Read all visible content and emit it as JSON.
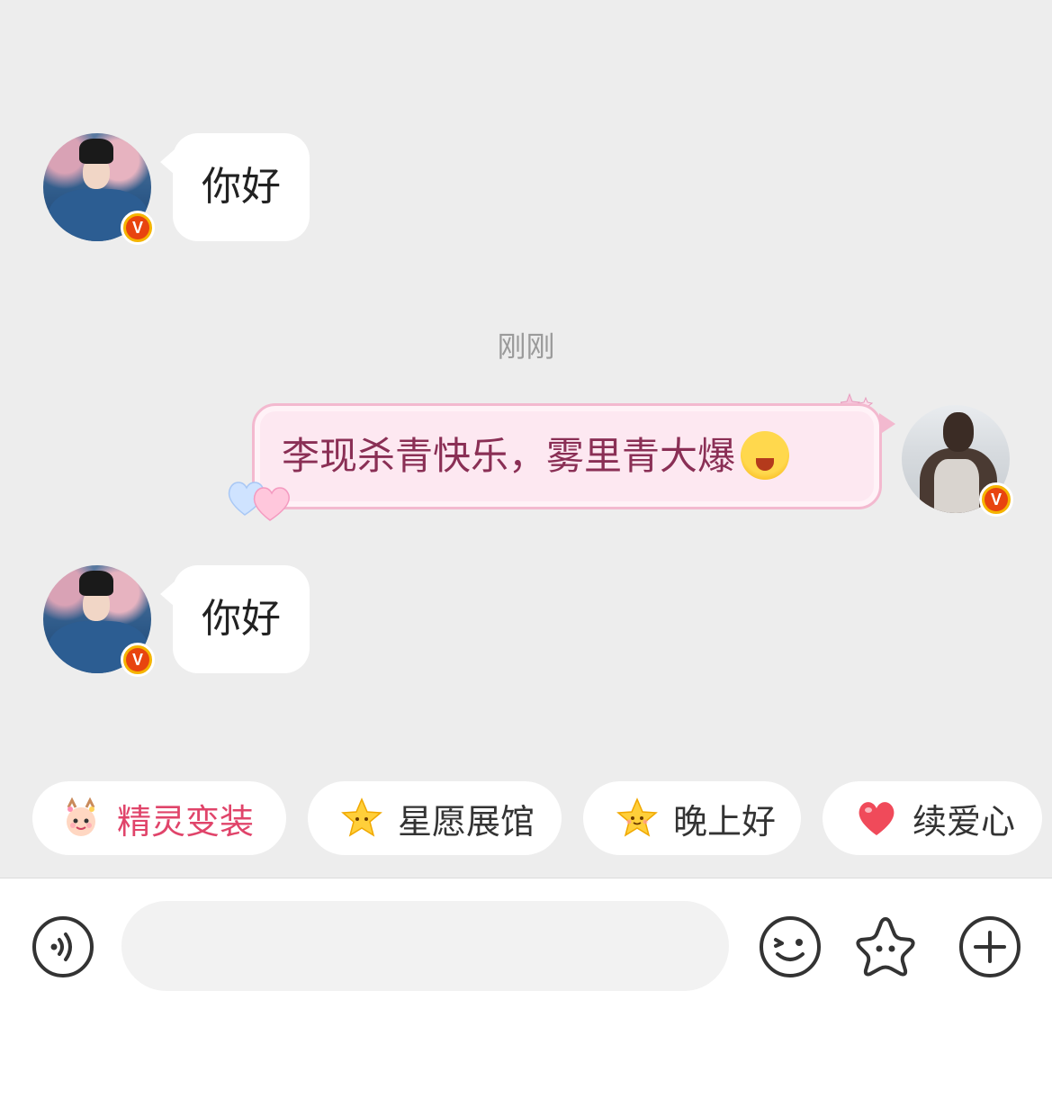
{
  "messages": [
    {
      "side": "left",
      "text": "你好",
      "avatar_badge": "V"
    },
    {
      "side": "right",
      "text": "李现杀青快乐，雾里青大爆",
      "emoji": "laughing-face",
      "avatar_badge": "V"
    },
    {
      "side": "left",
      "text": "你好",
      "avatar_badge": "V"
    }
  ],
  "timestamp": "刚刚",
  "chips": [
    {
      "label": "精灵变装",
      "icon": "fairy-deer-icon",
      "color": "#e0446a"
    },
    {
      "label": "星愿展馆",
      "icon": "star-face-icon"
    },
    {
      "label": "晚上好",
      "icon": "star-smile-icon"
    },
    {
      "label": "续爱心",
      "icon": "heart-icon",
      "color": "#f04a5a"
    }
  ],
  "input": {
    "placeholder": ""
  },
  "toolbar": {
    "icons": [
      "voice-icon",
      "emoji-icon",
      "star-sticker-icon",
      "plus-icon"
    ]
  },
  "colors": {
    "background": "#ededed",
    "bubble_pink": "#fde8f1",
    "bubble_pink_text": "#8a2f55",
    "badge_orange": "#e8440f",
    "badge_ring": "#f5b400"
  }
}
